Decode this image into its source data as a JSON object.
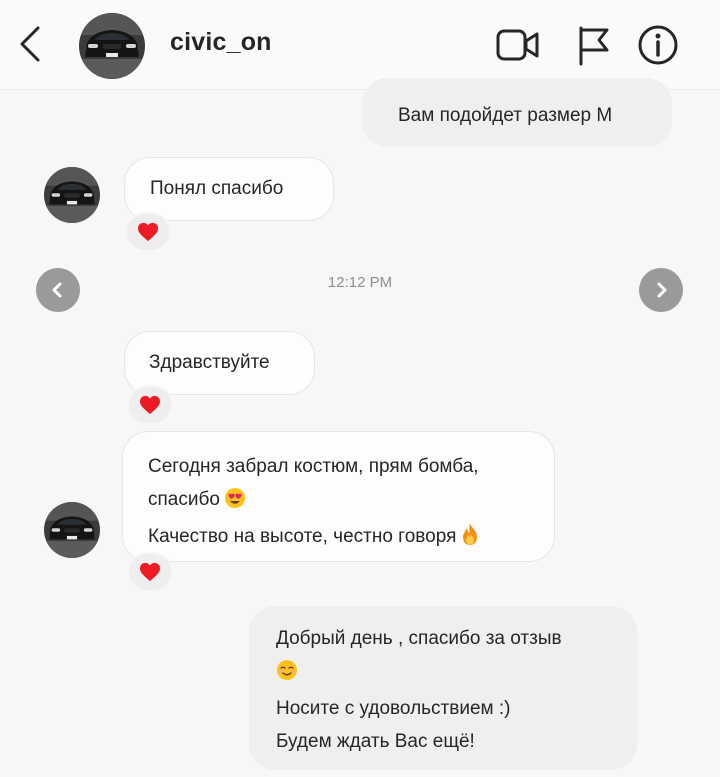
{
  "header": {
    "username": "civic_on",
    "icons": [
      "back-arrow-icon",
      "video-call-icon",
      "flag-icon",
      "info-icon"
    ]
  },
  "timestamp": "12:12 PM",
  "messages": [
    {
      "from": "me",
      "lines": [
        "Вам подойдет размер M"
      ]
    },
    {
      "from": "them",
      "lines": [
        "Понял спасибо"
      ],
      "reaction": "heart"
    },
    {
      "from": "them",
      "lines": [
        "Здравствуйте"
      ],
      "reaction": "heart"
    },
    {
      "from": "them",
      "lines": [
        "Сегодня забрал костюм, прям бомба,",
        "спасибо",
        "Качество на высоте, честно говоря"
      ],
      "emojis": [
        "heart-eyes-emoji",
        "fire-emoji"
      ],
      "reaction": "heart"
    },
    {
      "from": "me",
      "lines": [
        "Добрый день , спасибо за отзыв",
        "",
        "Носите с удовольствием :)",
        "Будем ждать Вас ещё!"
      ],
      "emojis": [
        "smiling-face-emoji"
      ]
    }
  ],
  "colors": {
    "background": "#f7f7f7",
    "incoming_bubble": "#fdfdfd",
    "outgoing_bubble": "#efefef",
    "heart": "#ed1c24",
    "nav_button": "#9a9a9a"
  }
}
